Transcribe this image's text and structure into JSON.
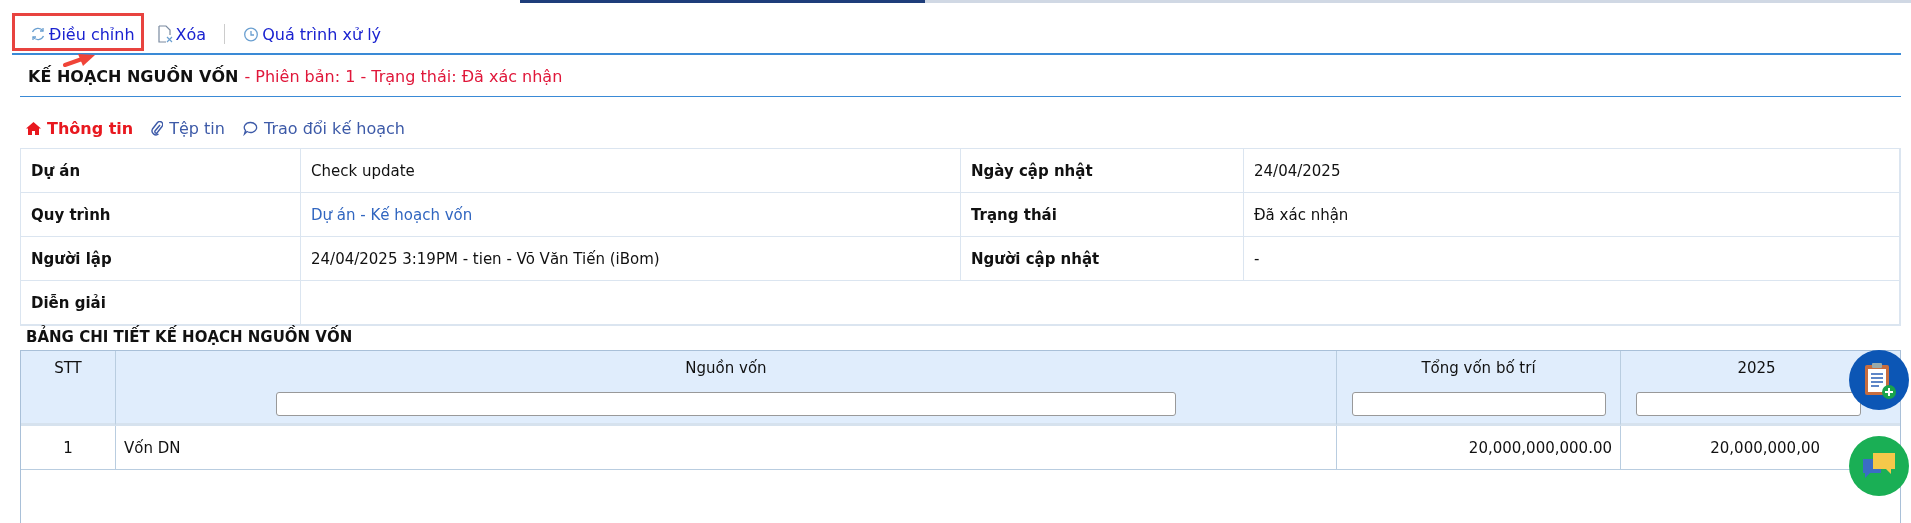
{
  "toolbar": [
    {
      "kind": "refresh",
      "label": "Điều chỉnh"
    },
    {
      "kind": "delete",
      "label": "Xóa"
    },
    {
      "kind": "history",
      "label": "Quá trình xử lý"
    }
  ],
  "header": {
    "title": "KẾ HOẠCH NGUỒN VỐN",
    "subtitle": "- Phiên bản: 1 - Trạng thái: Đã xác nhận"
  },
  "tabs": [
    {
      "kind": "home",
      "label": "Thông tin",
      "selected": true
    },
    {
      "kind": "attach",
      "label": "Tệp tin",
      "selected": false
    },
    {
      "kind": "chat",
      "label": "Trao đổi kế hoạch",
      "selected": false
    }
  ],
  "info_rows": [
    {
      "label": "Dự án",
      "value": "Check update",
      "link": false,
      "label_2": "Ngày cập nhật",
      "value_2": "24/04/2025"
    },
    {
      "label": "Quy trình",
      "value": "Dự án - Kế hoạch vốn",
      "link": true,
      "label_2": "Trạng thái",
      "value_2": "Đã xác nhận"
    },
    {
      "label": "Người lập",
      "value": "24/04/2025 3:19PM - tien - Võ Văn Tiến (iBom)",
      "link": false,
      "label_2": "Người cập nhật",
      "value_2": "-"
    },
    {
      "label": "Diễn giải"
    }
  ],
  "detail": {
    "title": "BẢNG CHI TIẾT KẾ HOẠCH NGUỒN VỐN",
    "columns": [
      "STT",
      "Nguồn vốn",
      "Tổng vốn bố trí",
      "2025"
    ],
    "rows": [
      [
        "1",
        "Vốn DN",
        "20,000,000,000.00",
        "20,000,000,00"
      ]
    ]
  }
}
